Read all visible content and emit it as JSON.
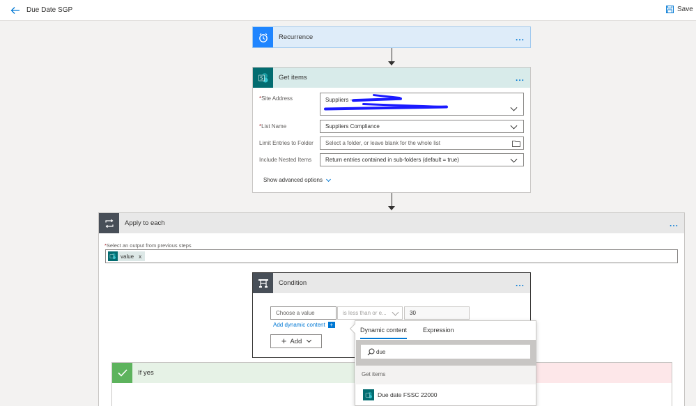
{
  "header": {
    "title": "Due Date SGP",
    "save_label": "Save"
  },
  "recurrence": {
    "title": "Recurrence",
    "more": "..."
  },
  "get_items": {
    "title": "Get items",
    "more": "...",
    "site_address": {
      "label": "Site Address",
      "value": "Suppliers - "
    },
    "list_name": {
      "label": "List Name",
      "value": "Suppliers Compliance"
    },
    "limit_folder": {
      "label": "Limit Entries to Folder",
      "placeholder": "Select a folder, or leave blank for the whole list"
    },
    "nested": {
      "label": "Include Nested Items",
      "value": "Return entries contained in sub-folders (default = true)"
    },
    "advanced": "Show advanced options"
  },
  "apply_each": {
    "title": "Apply to each",
    "more": "...",
    "select_label": "Select an output from previous steps",
    "token": "value",
    "token_remove": "x"
  },
  "condition": {
    "title": "Condition",
    "more": "...",
    "choose_placeholder": "Choose a value",
    "operator": "is less than or e...",
    "value": "30",
    "add_dynamic": "Add dynamic content",
    "add_label": "Add"
  },
  "if_yes": {
    "title": "If yes"
  },
  "dynamic_popup": {
    "tabs": [
      "Dynamic content",
      "Expression"
    ],
    "search_value": "due",
    "section": "Get items",
    "item": "Due date FSSC 22000"
  },
  "colors": {
    "accent": "#0078d4",
    "recurrence_head": "#deecf9",
    "sharepoint_head": "#d8ebea",
    "sharepoint_icon": "#036c70",
    "control_icon": "#484644",
    "yes_green": "#5db35d",
    "no_red": "#fde7e9"
  }
}
